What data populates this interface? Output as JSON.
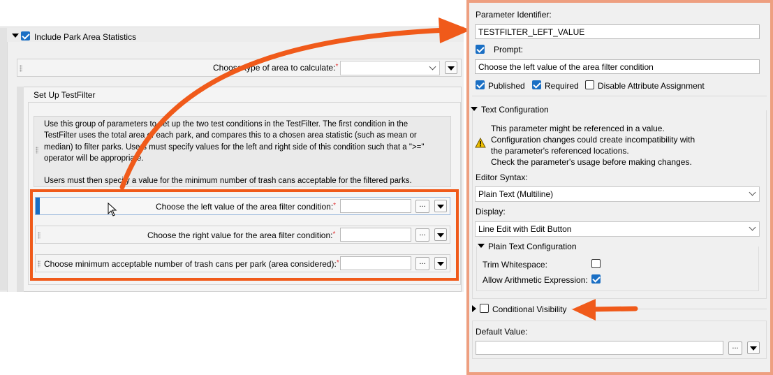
{
  "left_panel": {
    "group_title": "Include Park Area Statistics",
    "area_type_label": "Choose type of area to calculate:",
    "setup_title": "Set Up TestFilter",
    "description_lines": [
      "Use this group of parameters to set up the two test conditions in the TestFilter. The first condition in the",
      "TestFilter uses the total area of each park, and compares this to a chosen area statistic (such as mean or",
      "median) to filter parks. Users must specify values for the left and right side of this condition such that a \">=\"",
      "operator will be appropriate.",
      "",
      "Users must then specify a value for the minimum number of trash cans acceptable for the filtered parks."
    ],
    "param_left": "Choose the left value of the area filter condition:",
    "param_right": "Choose the right value for the area filter condition:",
    "param_trash": "Choose minimum acceptable number of trash cans per park (area considered):",
    "required_mark": "*",
    "ellipsis": "..."
  },
  "right_panel": {
    "param_id_label": "Parameter Identifier:",
    "param_id_value": "TESTFILTER_LEFT_VALUE",
    "prompt_label": "Prompt:",
    "prompt_value": "Choose the left value of the area filter condition",
    "published_label": "Published",
    "required_label": "Required",
    "disable_attr_label": "Disable Attribute Assignment",
    "text_config_title": "Text Configuration",
    "warning_lines": [
      "This parameter might be referenced in a value.",
      "Configuration changes could create incompatibility with",
      "the parameter's referenced locations.",
      "Check the parameter's usage before making changes."
    ],
    "editor_syntax_label": "Editor Syntax:",
    "editor_syntax_value": "Plain Text (Multiline)",
    "display_label": "Display:",
    "display_value": "Line Edit with Edit Button",
    "plain_text_config_title": "Plain Text Configuration",
    "trim_whitespace_label": "Trim Whitespace:",
    "allow_arith_label": "Allow Arithmetic Expression:",
    "conditional_visibility_label": "Conditional Visibility",
    "default_value_label": "Default Value:",
    "ellipsis": "..."
  },
  "colors": {
    "accent_orange": "#f05a1a",
    "frame_salmon": "#ee9f80",
    "checkbox_blue": "#1a6fc4"
  },
  "states": {
    "include_park_area_checked": true,
    "prompt_checked": true,
    "published_checked": true,
    "required_checked": true,
    "disable_attr_checked": false,
    "trim_whitespace_checked": false,
    "allow_arith_checked": true,
    "conditional_visibility_checked": false
  }
}
